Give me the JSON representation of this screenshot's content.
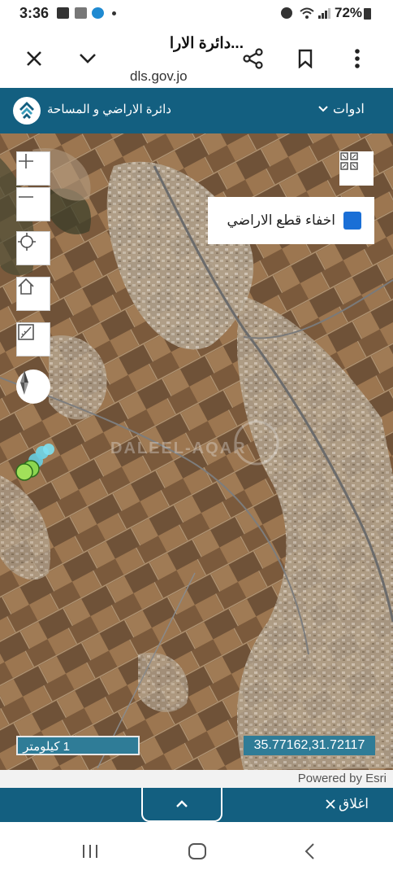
{
  "status_bar": {
    "time": "3:36",
    "battery": "72%"
  },
  "browser": {
    "title": "...دائرة الارا",
    "url": "dls.gov.jo"
  },
  "site_header": {
    "name": "دائرة الاراضي و المساحة",
    "tools_label": "ادوات"
  },
  "map": {
    "hide_parcels_label": "اخفاء قطع الاراضي",
    "hide_parcels_checked": true,
    "watermark_text": "DALEEL-AQAR",
    "scale_label": "1 كيلومتر",
    "coordinates": "35.77162,31.72117",
    "attribution": "Powered by Esri"
  },
  "footer": {
    "close_label": "اغلاق"
  },
  "icons": {
    "close": "close-icon",
    "chevron": "chevron-down-icon",
    "share": "share-icon",
    "bookmark": "bookmark-icon",
    "more": "more-vert-icon",
    "zoom_in": "plus-icon",
    "zoom_out": "minus-icon",
    "locate": "locate-icon",
    "home": "home-icon",
    "measure": "measure-icon",
    "compass": "compass-icon",
    "layers": "grid-icon"
  },
  "colors": {
    "header": "#135f80",
    "accent": "#1a6fd6",
    "label_box": "#2f7c97"
  }
}
